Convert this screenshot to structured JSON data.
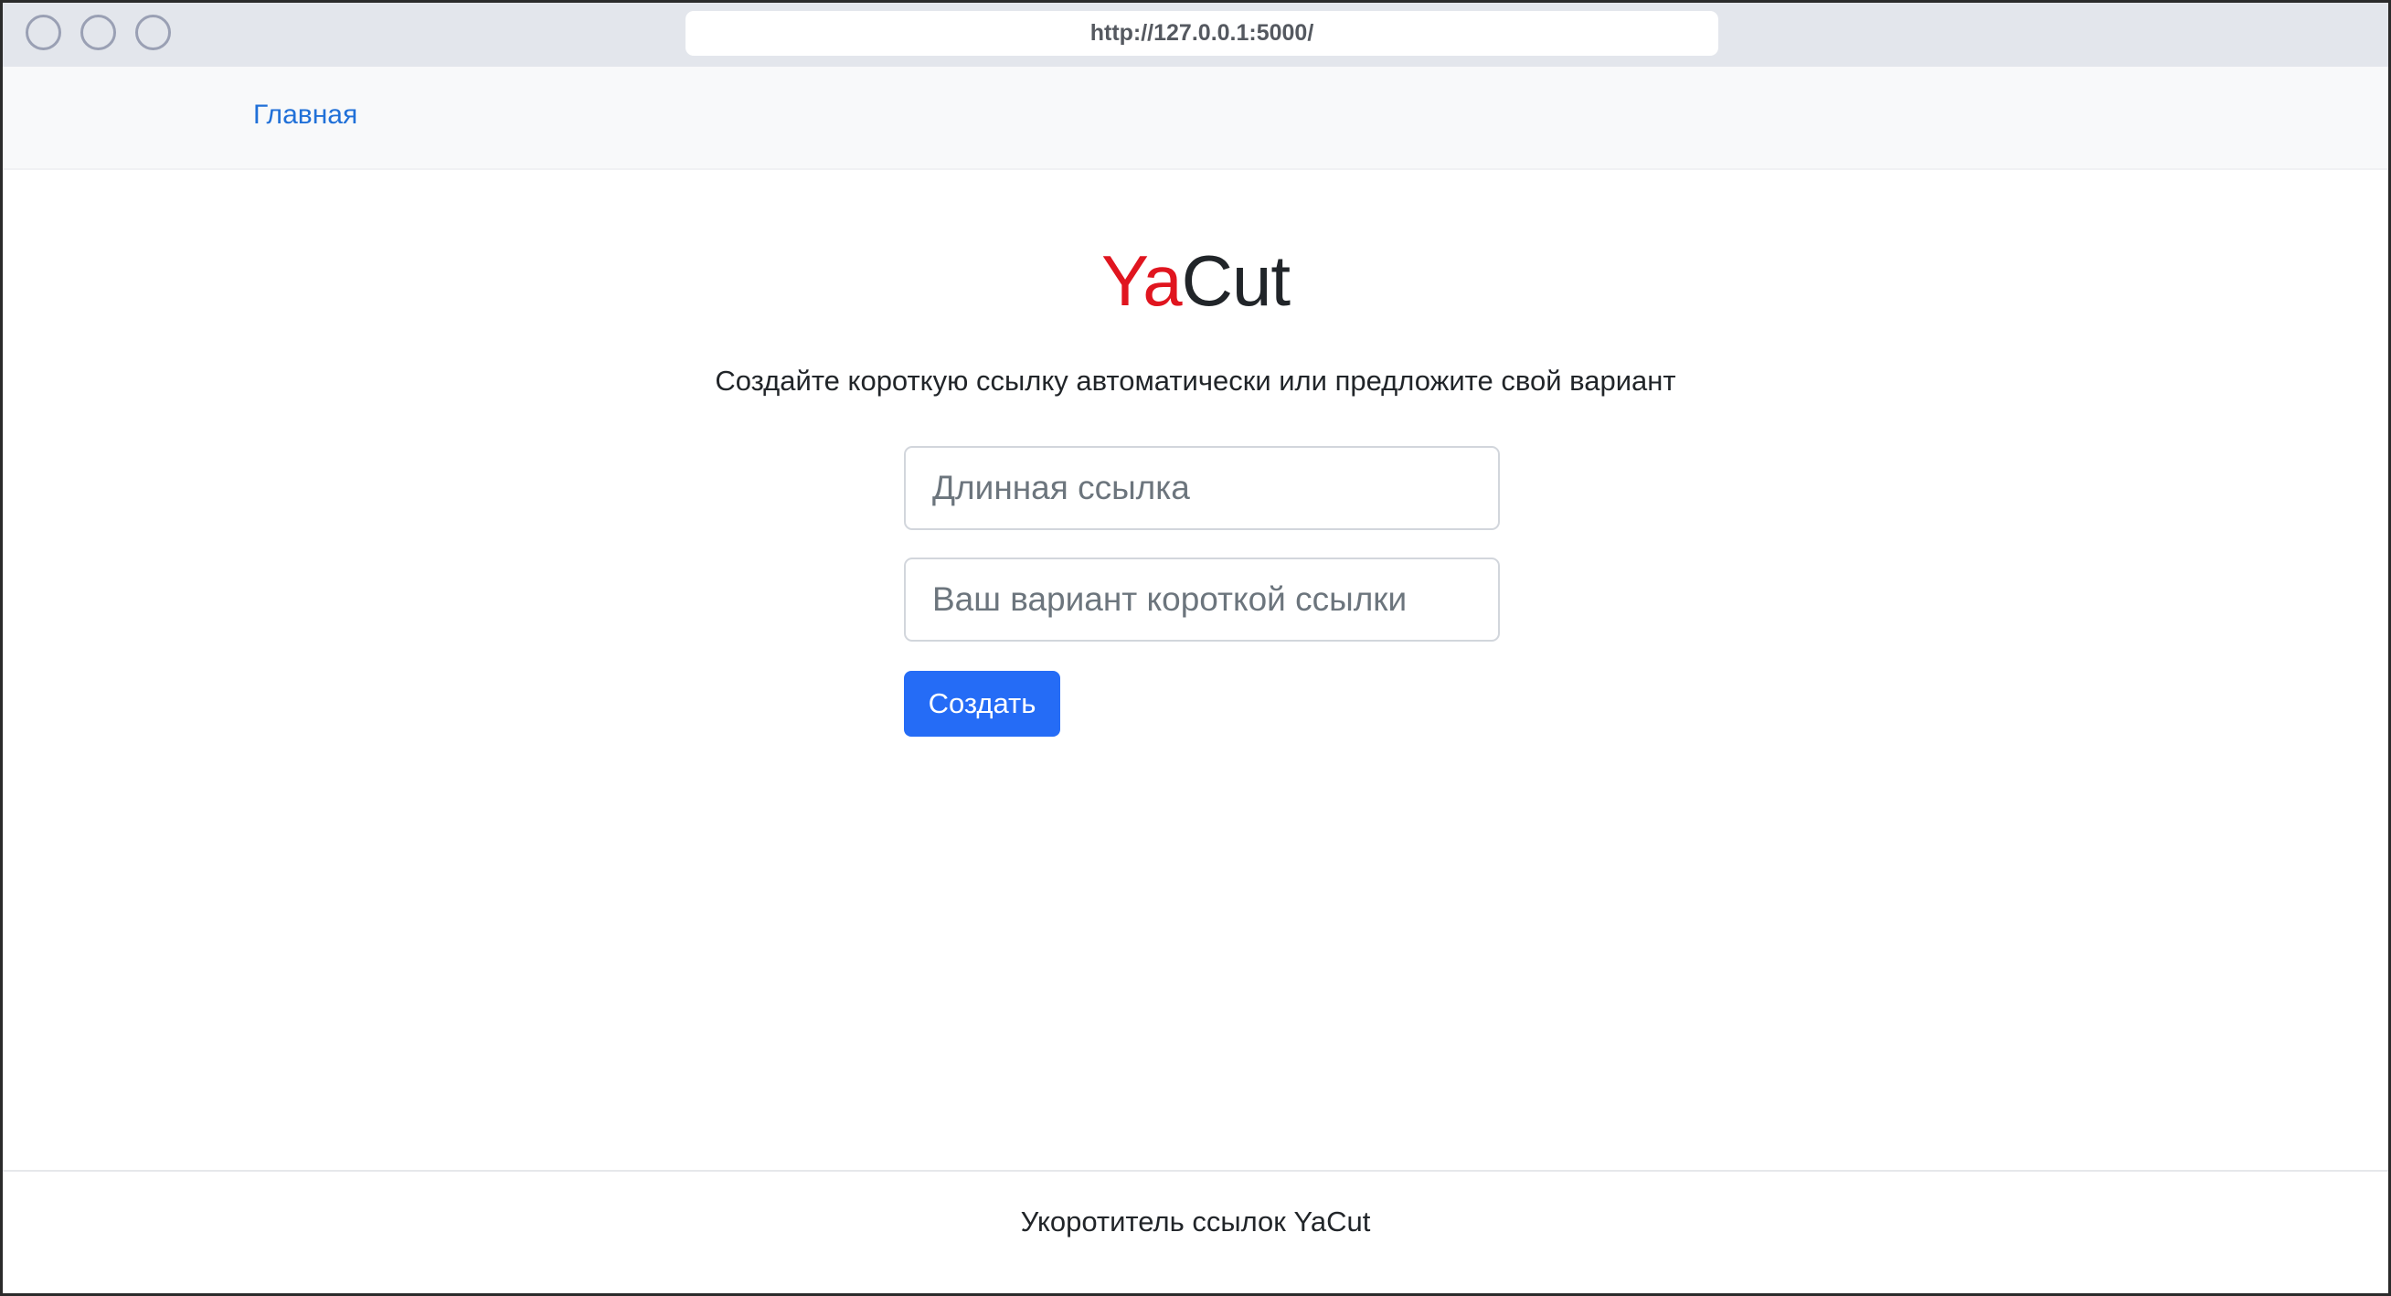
{
  "browser": {
    "url": "http://127.0.0.1:5000/"
  },
  "navbar": {
    "home_link": "Главная"
  },
  "main": {
    "logo_part1": "Ya",
    "logo_part2": "Cut",
    "subtitle": "Создайте короткую ссылку автоматически или предложите свой вариант",
    "original_link": {
      "value": "",
      "placeholder": "Длинная ссылка"
    },
    "custom_id": {
      "value": "",
      "placeholder": "Ваш вариант короткой ссылки"
    },
    "submit_label": "Создать"
  },
  "footer": {
    "text": "Укоротитель ссылок YaCut"
  },
  "colors": {
    "accent": "#256cf6",
    "link": "#2070d8",
    "logo_red": "#e0151f",
    "navbar_bg": "#f8f9fa",
    "chrome_bg": "#e3e6ec"
  }
}
